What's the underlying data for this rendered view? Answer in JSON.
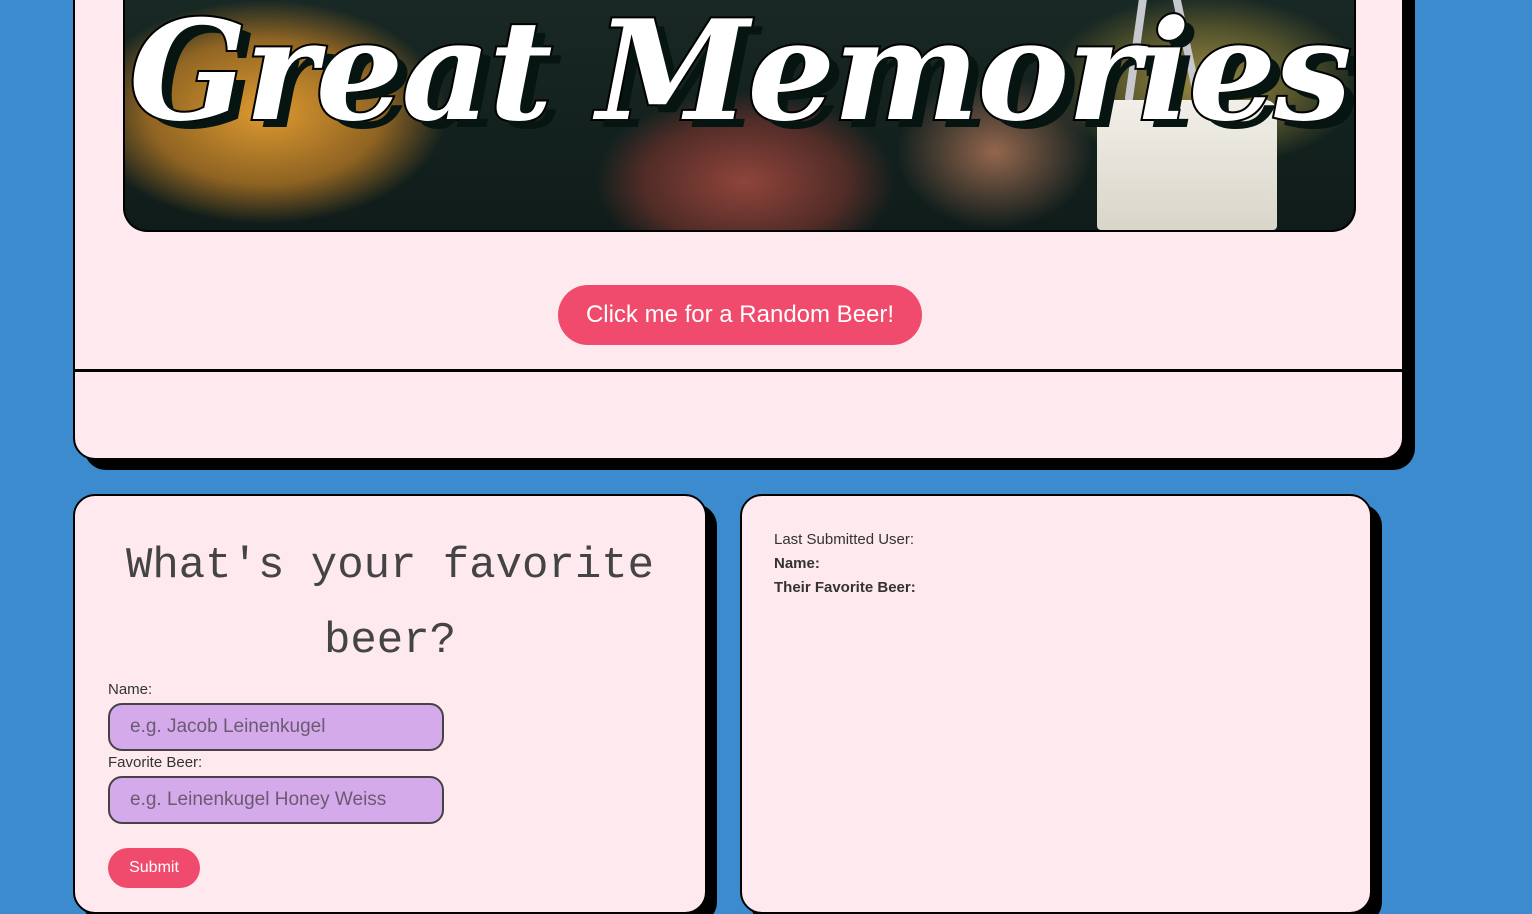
{
  "hero": {
    "title": "Great Memories"
  },
  "random_button": {
    "label": "Click me for a Random Beer!"
  },
  "form": {
    "title": "What's your favorite beer?",
    "name_label": "Name:",
    "name_placeholder": "e.g. Jacob Leinenkugel",
    "beer_label": "Favorite Beer:",
    "beer_placeholder": "e.g. Leinenkugel Honey Weiss",
    "submit_label": "Submit"
  },
  "result": {
    "heading": "Last Submitted User:",
    "name_label": "Name:",
    "beer_label": "Their Favorite Beer:"
  },
  "colors": {
    "background": "#3d8bcf",
    "card": "#fde9ee",
    "accent": "#f04a6c",
    "input": "#d5aaea"
  }
}
